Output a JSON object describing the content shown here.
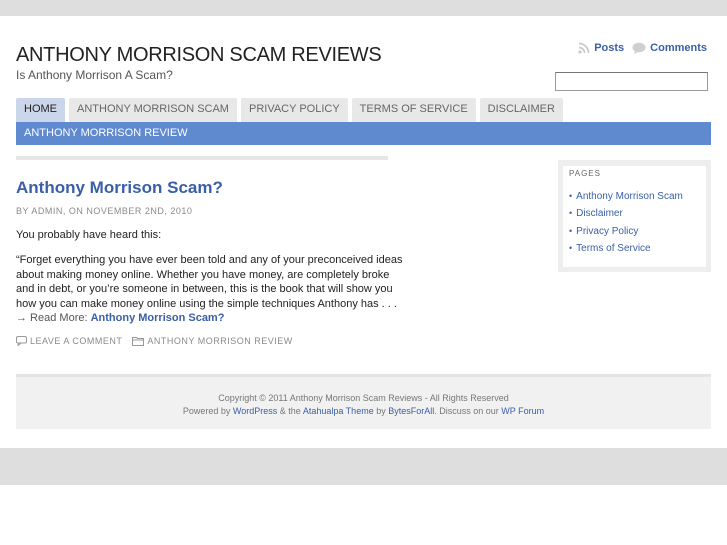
{
  "header": {
    "site_title": "ANTHONY MORRISON SCAM REVIEWS",
    "tagline": "Is Anthony Morrison A Scam?",
    "feeds": {
      "posts": "Posts",
      "comments": "Comments"
    },
    "search": {
      "value": "",
      "placeholder": ""
    }
  },
  "nav": {
    "tabs": [
      {
        "label": "HOME",
        "active": true
      },
      {
        "label": "ANTHONY MORRISON SCAM"
      },
      {
        "label": "PRIVACY POLICY"
      },
      {
        "label": "TERMS OF SERVICE"
      },
      {
        "label": "DISCLAIMER"
      }
    ],
    "subnav_label": "ANTHONY MORRISON REVIEW"
  },
  "post": {
    "title": "Anthony Morrison Scam?",
    "meta": "BY ADMIN, ON NOVEMBER 2ND, 2010",
    "intro": "You probably have heard this:",
    "excerpt_lines": [
      "“Forget everything you have ever been told and any of your preconceived ideas",
      "about making money online. Whether you have money, are completely broke",
      "and in debt, or you’re someone in between, this is the book that will show you",
      "how you can make money online using the simple techniques Anthony has . . ."
    ],
    "read_more_prefix": "→ Read More:",
    "read_more_link": "Anthony Morrison Scam?",
    "leave_comment": "LEAVE A COMMENT",
    "category": "ANTHONY MORRISON REVIEW"
  },
  "sidebar": {
    "title": "PAGES",
    "items": [
      "Anthony Morrison Scam",
      "Disclaimer",
      "Privacy Policy",
      "Terms of Service"
    ]
  },
  "footer": {
    "copyright": "Copyright © 2011 Anthony Morrison Scam Reviews - All Rights Reserved",
    "powered_parts": [
      "Powered by ",
      "WordPress",
      " & the ",
      "Atahualpa Theme",
      " by ",
      "BytesForAll",
      ". Discuss on our ",
      "WP Forum"
    ]
  },
  "colors": {
    "accent": "#3a5fa8",
    "subnav_bg": "#5f8ad0",
    "active_tab": "#ccd6ea"
  },
  "icons": {
    "posts": "rss-icon",
    "comments": "speech-bubble-icon",
    "comment": "comment-icon",
    "category": "folder-icon"
  }
}
